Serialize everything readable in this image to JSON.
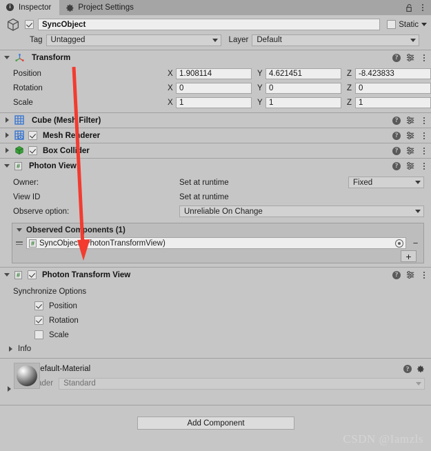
{
  "tabs": [
    {
      "label": "Inspector",
      "icon": "info-icon",
      "active": true
    },
    {
      "label": "Project Settings",
      "icon": "gear-icon",
      "active": false
    }
  ],
  "window_controls": {
    "lock": "lock-icon",
    "menu": "kebab-menu-icon"
  },
  "object_header": {
    "enabled": true,
    "name": "SyncObject",
    "static_label": "Static",
    "static_checked": false,
    "tag_label": "Tag",
    "tag_value": "Untagged",
    "layer_label": "Layer",
    "layer_value": "Default"
  },
  "transform": {
    "title": "Transform",
    "expanded": true,
    "rows": [
      {
        "label": "Position",
        "x": "1.908114",
        "y": "4.621451",
        "z": "-8.423833"
      },
      {
        "label": "Rotation",
        "x": "0",
        "y": "0",
        "z": "0"
      },
      {
        "label": "Scale",
        "x": "1",
        "y": "1",
        "z": "1"
      }
    ],
    "axis_labels": [
      "X",
      "Y",
      "Z"
    ]
  },
  "components": [
    {
      "title": "Cube (Mesh Filter)",
      "icon": "mesh-filter-icon",
      "expanded": false,
      "has_toggle": false,
      "enabled": false
    },
    {
      "title": "Mesh Renderer",
      "icon": "mesh-renderer-icon",
      "expanded": false,
      "has_toggle": true,
      "enabled": true
    },
    {
      "title": "Box Collider",
      "icon": "box-collider-icon",
      "expanded": false,
      "has_toggle": true,
      "enabled": true
    }
  ],
  "photon_view": {
    "title": "Photon View",
    "icon": "script-icon",
    "expanded": true,
    "rows": [
      {
        "label": "Owner:",
        "value": "Set at runtime"
      },
      {
        "label": "View ID",
        "value": "Set at runtime"
      }
    ],
    "ownership_value": "Fixed",
    "observe_label": "Observe option:",
    "observe_value": "Unreliable On Change",
    "observed": {
      "title": "Observed Components (1)",
      "items": [
        {
          "name": "SyncObject (PhotonTransformView)"
        }
      ],
      "remove_label": "−",
      "add_label": "+"
    }
  },
  "photon_transform_view": {
    "title": "Photon Transform View",
    "icon": "script-icon",
    "expanded": true,
    "enabled": true,
    "section_label": "Synchronize Options",
    "options": [
      {
        "label": "Position",
        "checked": true
      },
      {
        "label": "Rotation",
        "checked": true
      },
      {
        "label": "Scale",
        "checked": false
      }
    ],
    "info_label": "Info"
  },
  "material": {
    "name": "Default-Material",
    "shader_label": "Shader",
    "shader_value": "Standard"
  },
  "footer": {
    "add_component_label": "Add Component"
  },
  "watermark": "CSDN @Iamzls",
  "annotation": {
    "type": "arrow",
    "color": "#f33b30"
  },
  "colors": {
    "background": "#c6c6c6",
    "tabbar": "#a5a5a5",
    "field": "#eeeeee",
    "separator": "#a0a0a0",
    "accent_red": "#f33b30"
  }
}
